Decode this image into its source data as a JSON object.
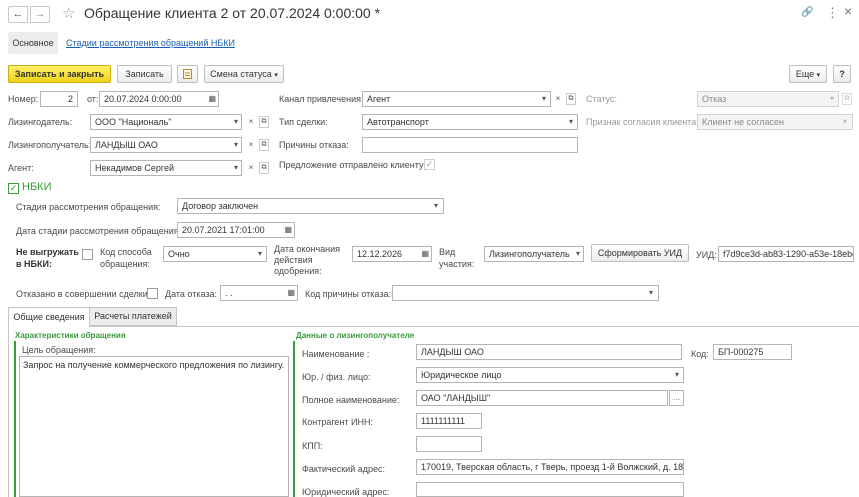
{
  "window": {
    "title": "Обращение клиента 2 от 20.07.2024 0:00:00 *",
    "nav_back": "←",
    "nav_forward": "→",
    "star": "☆",
    "link_icon": "🔗",
    "more_icon": "⋮",
    "close_icon": "×"
  },
  "tabs": {
    "main": "Основное",
    "stages_link": "Стадии рассмотрения обращений НБКИ"
  },
  "toolbar": {
    "save_close": "Записать и закрыть",
    "save": "Записать",
    "status_change": "Смена статуса",
    "more": "Еще",
    "help": "?"
  },
  "header_fields": {
    "number_label": "Номер:",
    "number_value": "2",
    "date_label": "от:",
    "date_value": "20.07.2024  0:00:00",
    "lessor_label": "Лизингодатель:",
    "lessor_value": "ООО \"Националь\"",
    "lessee_label": "Лизингополучатель:",
    "lessee_value": "ЛАНДЫШ ОАО",
    "agent_label": "Агент:",
    "agent_value": "Некадимов Сергей",
    "channel_label": "Канал привлечения:",
    "channel_value": "Агент",
    "deal_type_label": "Тип сделки:",
    "deal_type_value": "Автотранспорт",
    "refusal_reasons_label": "Причины отказа:",
    "refusal_reasons_value": "",
    "offer_sent_label": "Предложение отправлено клиенту",
    "status_label": "Статус:",
    "status_value": "Отказ",
    "consent_label": "Признак согласия клиента:",
    "consent_value": "Клиент не согласен"
  },
  "nbki": {
    "section_label": "НБКИ",
    "stage_label": "Стадия рассмотрения обращения:",
    "stage_value": "Договор заключен",
    "stage_date_label": "Дата стадии рассмотрения обращения:",
    "stage_date_value": "20.07.2021 17:01:00",
    "no_upload_label_1": "Не выгружать",
    "no_upload_label_2": "в НБКИ:",
    "method_label_1": "Код способа",
    "method_label_2": "обращения:",
    "method_value": "Очно",
    "approval_end_label_1": "Дата окончания",
    "approval_end_label_2": "действия",
    "approval_end_label_3": "одобрения:",
    "approval_end_value": "12.12.2026",
    "participation_label_1": "Вид",
    "participation_label_2": "участия:",
    "participation_value": "Лизингополучатель",
    "generate_uid": "Сформировать УИД",
    "uid_label": "УИД:",
    "uid_value": "f7d9ce3d-ab83-1290-a53e-18ebd",
    "refused_label": "Отказано в совершении сделки:",
    "refusal_date_label": "Дата отказа:",
    "refusal_date_value": " .  .",
    "refusal_code_label": "Код причины отказа:",
    "refusal_code_value": ""
  },
  "bottom_tabs": {
    "general": "Общие сведения",
    "payments": "Расчеты платежей"
  },
  "left_panel": {
    "header": "Характеристики обращения",
    "purpose_label": "Цель обращения:",
    "purpose_value": "Запрос на получение коммерческого предложения по лизингу."
  },
  "right_panel": {
    "header": "Данные о лизингополучателе",
    "name_label": "Наименование :",
    "name_value": "ЛАНДЫШ ОАО",
    "code_label": "Код:",
    "code_value": "БП-000275",
    "entity_label": "Юр. / физ. лицо:",
    "entity_value": "Юридическое лицо",
    "full_name_label": "Полное наименование:",
    "full_name_value": "ОАО \"ЛАНДЫШ\"",
    "inn_label": "Контрагент ИНН:",
    "inn_value": "1111111111",
    "kpp_label": "КПП:",
    "kpp_value": "",
    "address_label": "Фактический адрес:",
    "address_value": "170019, Тверская область, г Тверь, проезд 1-й Волжский, д. 18",
    "legal_address_label": "Юридический адрес:"
  }
}
